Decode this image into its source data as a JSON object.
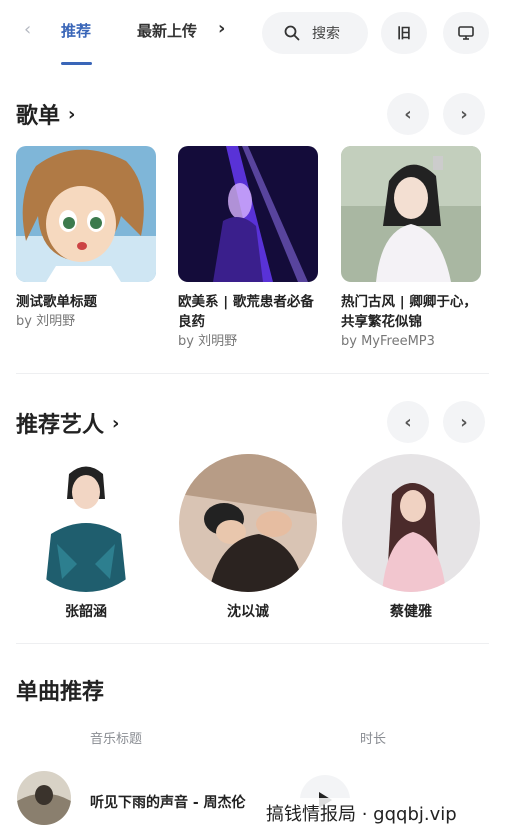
{
  "nav": {
    "back_glyph": "‹",
    "tabs": [
      {
        "label": "推荐"
      },
      {
        "label": "最新上传"
      }
    ],
    "next_glyph": "›",
    "search_label": "搜索",
    "theme_button_label": "旧",
    "screen_icon": "monitor-icon"
  },
  "playlists": {
    "title": "歌单",
    "items": [
      {
        "title": "测试歌单标题",
        "by": "by 刘明野"
      },
      {
        "title": "欧美系 | 歌荒患者必备良药",
        "by": "by 刘明野"
      },
      {
        "title": "热门古风 | 卿卿于心，共享繁花似锦",
        "by": "by MyFreeMP3"
      }
    ]
  },
  "artists": {
    "title": "推荐艺人",
    "items": [
      {
        "name": "张韶涵"
      },
      {
        "name": "沈以诚"
      },
      {
        "name": "蔡健雅"
      }
    ]
  },
  "songs": {
    "title": "单曲推荐",
    "columns": {
      "title": "音乐标题",
      "duration": "时长"
    },
    "rows": [
      {
        "title": "听见下雨的声音 - 周杰伦"
      }
    ]
  },
  "watermark": "搞钱情报局 · gqqbj.vip",
  "colors": {
    "accent": "#3a66b8",
    "pill_bg": "#f3f4f6"
  }
}
